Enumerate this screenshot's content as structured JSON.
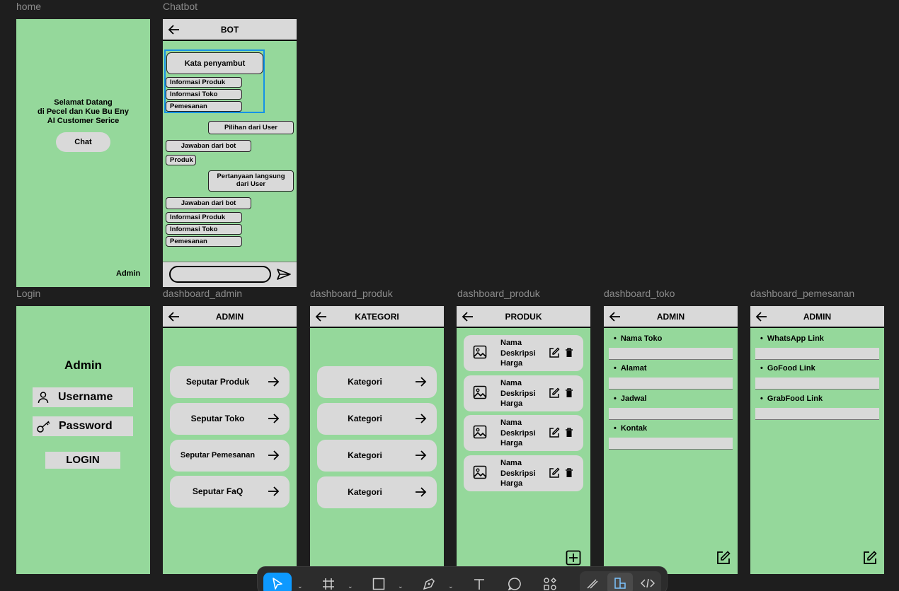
{
  "frames": {
    "home": {
      "label": "home",
      "welcome": [
        "Selamat Datang",
        "di Pecel dan Kue Bu Eny",
        "AI Customer Serice"
      ],
      "chat_button": "Chat",
      "admin_link": "Admin"
    },
    "chatbot": {
      "label": "Chatbot",
      "title": "BOT",
      "greeting": "Kata penyambut",
      "menu_top": [
        "Informasi Produk",
        "Informasi Toko",
        "Pemesanan"
      ],
      "user_choice": "Pilihan dari User",
      "bot_answer_1": "Jawaban dari bot",
      "product": "Produk",
      "user_question": "Pertanyaan langsung dari User",
      "bot_answer_2": "Jawaban dari bot",
      "menu_bottom": [
        "Informasi Produk",
        "Informasi Toko",
        "Pemesanan"
      ],
      "input_placeholder": ""
    },
    "login": {
      "label": "Login",
      "title": "Admin",
      "username": "Username",
      "password": "Password",
      "login_button": "LOGIN"
    },
    "dashboard_admin": {
      "label": "dashboard_admin",
      "title": "ADMIN",
      "items": [
        "Seputar Produk",
        "Seputar Toko",
        "Seputar Pemesanan",
        "Seputar FaQ"
      ]
    },
    "dashboard_kategori": {
      "label": "dashboard_produk",
      "title": "KATEGORI",
      "items": [
        "Kategori",
        "Kategori",
        "Kategori",
        "Kategori"
      ]
    },
    "dashboard_produk": {
      "label": "dashboard_produk",
      "title": "PRODUK",
      "products": [
        {
          "name": "Nama",
          "desc": "Deskripsi",
          "price": "Harga"
        },
        {
          "name": "Nama",
          "desc": "Deskripsi",
          "price": "Harga"
        },
        {
          "name": "Nama",
          "desc": "Deskripsi",
          "price": "Harga"
        },
        {
          "name": "Nama",
          "desc": "Deskripsi",
          "price": "Harga"
        }
      ]
    },
    "dashboard_toko": {
      "label": "dashboard_toko",
      "title": "ADMIN",
      "fields": [
        "Nama Toko",
        "Alamat",
        "Jadwal",
        "Kontak"
      ]
    },
    "dashboard_pemesanan": {
      "label": "dashboard_pemesanan",
      "title": "ADMIN",
      "fields": [
        "WhatsApp Link",
        "GoFood Link",
        "GrabFood Link"
      ]
    }
  },
  "toolbar": {
    "tools": [
      "move-icon",
      "frame-icon",
      "rectangle-icon",
      "pen-icon",
      "text-icon",
      "comment-icon",
      "actions-icon",
      "draw-icon",
      "design-icon",
      "dev-mode-icon"
    ]
  },
  "colors": {
    "canvas": "#1e1e1e",
    "frame_bg": "#95d89b",
    "element": "#d9d9d9",
    "selection": "#1592e6",
    "tool_active": "#0d99ff"
  }
}
